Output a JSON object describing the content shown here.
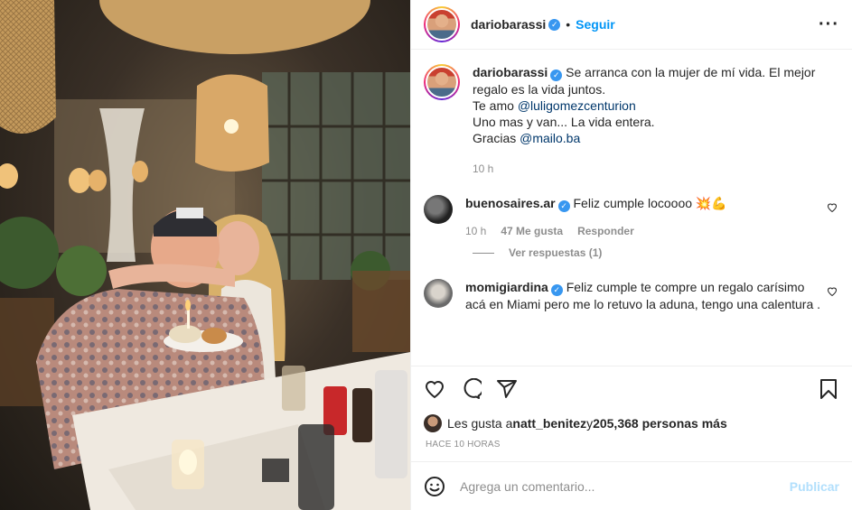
{
  "post": {
    "username": "dariobarassi",
    "follow_label": "Seguir",
    "caption": {
      "text1": "Se arranca con la mujer de mí vida. El mejor regalo es la vida juntos.",
      "text2": "Te amo ",
      "mention1": "@luligomezcenturion",
      "text3": "Uno mas y van... La vida entera.",
      "text4": "Gracias ",
      "mention2": "@mailo.ba",
      "time": "10 h"
    },
    "comments": [
      {
        "username": "buenosaires.ar",
        "text": "Feliz cumple locoooo 💥💪",
        "time": "10 h",
        "likes": "47 Me gusta",
        "reply": "Responder",
        "view_replies": "Ver respuestas (1)"
      },
      {
        "username": "momigiardina",
        "text": "Feliz cumple te compre un regalo carísimo acá en Miami pero me lo retuvo la aduna, tengo una calentura ."
      }
    ],
    "likes": {
      "prefix": "Les gusta a ",
      "user": "natt_benitez",
      "middle": " y ",
      "count": "205,368 personas más"
    },
    "posted_ago": "HACE 10 HORAS",
    "add_comment_placeholder": "Agrega un comentario...",
    "publish_label": "Publicar"
  },
  "colors": {
    "link": "#00376b",
    "follow": "#0095f6",
    "verified": "#3897f0",
    "publish_disabled": "#b2dffc"
  }
}
